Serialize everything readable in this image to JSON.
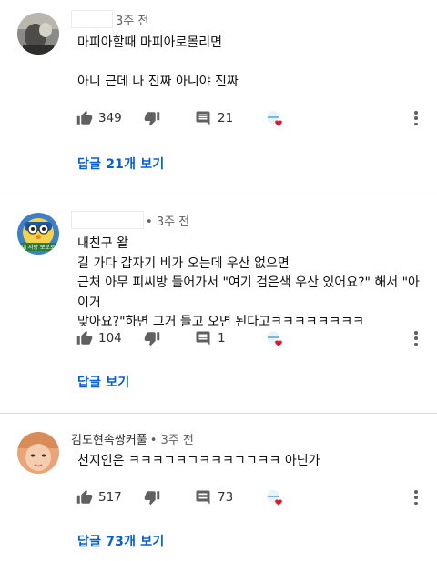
{
  "comments": [
    {
      "author": "",
      "time": "3주 전",
      "lines": [
        "마피아할때 마피아로몰리면",
        "",
        "아니 근데 나 진짜 아니야 진짜"
      ],
      "likes": "349",
      "replies": "21",
      "reply_link": "답글 21개 보기"
    },
    {
      "author": "",
      "time": "3주 전",
      "lines": [
        "내친구 왈",
        "길 가다 갑자기 비가 오는데 우산 없으면",
        "근처 아무 피씨방 들어가서 \"여기 검은색 우산 있어요?\" 해서 \"아 이거",
        "맞아요?\"하면 그거 들고 오면 된다고ㅋㅋㅋㅋㅋㅋㅋㅋ"
      ],
      "likes": "104",
      "replies": "1",
      "reply_link": "답글 보기",
      "avatar_badge": "내 사랑 뽀로로"
    },
    {
      "author": "김도현속쌍커풀",
      "time": "3주 전",
      "lines": [
        "천지인은 ㅋㅋㅋㄱㅋㄱㅋㅋㅋㄱㄱㅋㅋ 아닌가"
      ],
      "likes": "517",
      "replies": "73",
      "reply_link": "답글 73개 보기"
    }
  ],
  "icons": {
    "like": "thumbs-up-icon",
    "dislike": "thumbs-down-icon",
    "reply": "comment-icon",
    "more": "more-vert-icon",
    "heart": "creator-heart-icon"
  },
  "colors": {
    "link": "#065fd4",
    "heart": "#e0162b",
    "icon": "#606060"
  }
}
